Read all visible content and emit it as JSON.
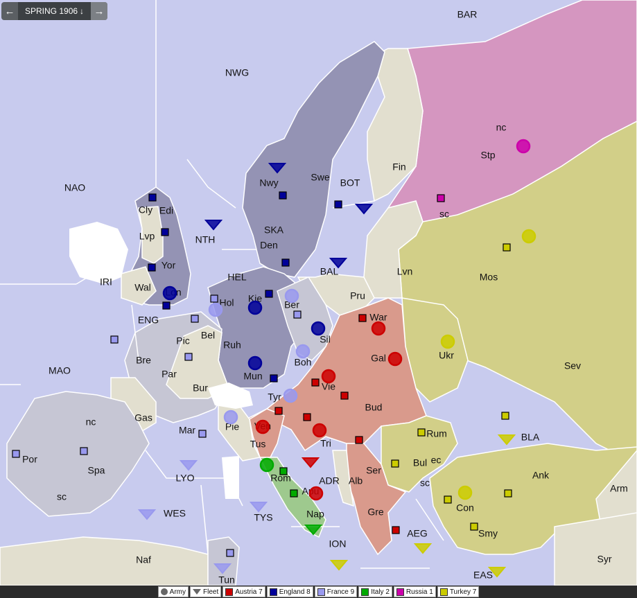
{
  "toolbar": {
    "prev_icon": "←",
    "season": "SPRING 1906",
    "season_icon": "↓",
    "next_icon": "→"
  },
  "colors": {
    "sea": "#c8cbee",
    "neutral": "#e2dfcf",
    "austria": "#d99a8c",
    "england": "#9493b4",
    "france": "#c6c6d4",
    "italy": "#9ec98e",
    "russia": "#d596c0",
    "turkey": "#d2cf88"
  },
  "legend": {
    "army": "Army",
    "fleet": "Fleet",
    "powers": [
      {
        "label": "Austria 7",
        "color": "#cc0000"
      },
      {
        "label": "England 8",
        "color": "#000099"
      },
      {
        "label": "France 9",
        "color": "#9999ee"
      },
      {
        "label": "Italy 2",
        "color": "#00aa00"
      },
      {
        "label": "Russia 1",
        "color": "#cc00aa"
      },
      {
        "label": "Turkey 7",
        "color": "#cccc00"
      }
    ]
  },
  "labels": [
    "BAR",
    "NWG",
    "NAO",
    "Cly",
    "Edi",
    "Lvp",
    "Yor",
    "Wal",
    "Lon",
    "IRI",
    "ENG",
    "NTH",
    "SKA",
    "Nwy",
    "Swe",
    "Fin",
    "BOT",
    "Stp",
    "nc",
    "sc",
    "Den",
    "HEL",
    "BAL",
    "Kie",
    "Ber",
    "Pru",
    "Lvn",
    "Mos",
    "Hol",
    "Bel",
    "Ruh",
    "Pic",
    "Bre",
    "Par",
    "Bur",
    "Mun",
    "Sil",
    "War",
    "Gal",
    "Boh",
    "Ukr",
    "Sev",
    "Tyr",
    "Vie",
    "Bud",
    "Gas",
    "Mar",
    "Pie",
    "Ven",
    "Tri",
    "Rum",
    "BLA",
    "MAO",
    "Spa",
    "Por",
    "sc",
    "nc",
    "LYO",
    "Tus",
    "Rom",
    "Apu",
    "ADR",
    "Ser",
    "Bul",
    "ec",
    "sc",
    "Alb",
    "Ank",
    "Arm",
    "Con",
    "WES",
    "TYS",
    "Nap",
    "Gre",
    "AEG",
    "Smy",
    "ION",
    "EAS",
    "Naf",
    "Tun",
    "Syr"
  ],
  "units": [
    {
      "type": "army",
      "power": "england",
      "province": "Lon"
    },
    {
      "type": "army",
      "power": "england",
      "province": "Kie"
    },
    {
      "type": "army",
      "power": "england",
      "province": "Sil"
    },
    {
      "type": "army",
      "power": "england",
      "province": "Mun"
    },
    {
      "type": "fleet",
      "power": "england",
      "province": "NTH"
    },
    {
      "type": "fleet",
      "power": "england",
      "province": "Nwy"
    },
    {
      "type": "fleet",
      "power": "england",
      "province": "BOT"
    },
    {
      "type": "fleet",
      "power": "england",
      "province": "BAL"
    },
    {
      "type": "army",
      "power": "france",
      "province": "Ber"
    },
    {
      "type": "army",
      "power": "france",
      "province": "Hol"
    },
    {
      "type": "army",
      "power": "france",
      "province": "Boh"
    },
    {
      "type": "army",
      "power": "france",
      "province": "Tyr"
    },
    {
      "type": "army",
      "power": "france",
      "province": "Pie"
    },
    {
      "type": "fleet",
      "power": "france",
      "province": "LYO"
    },
    {
      "type": "fleet",
      "power": "france",
      "province": "WES"
    },
    {
      "type": "fleet",
      "power": "france",
      "province": "TYS"
    },
    {
      "type": "fleet",
      "power": "france",
      "province": "Tun"
    },
    {
      "type": "army",
      "power": "austria",
      "province": "War"
    },
    {
      "type": "army",
      "power": "austria",
      "province": "Gal"
    },
    {
      "type": "army",
      "power": "austria",
      "province": "Vie"
    },
    {
      "type": "army",
      "power": "austria",
      "province": "Ven"
    },
    {
      "type": "army",
      "power": "austria",
      "province": "Tri"
    },
    {
      "type": "army",
      "power": "austria",
      "province": "Apu"
    },
    {
      "type": "fleet",
      "power": "austria",
      "province": "ADR"
    },
    {
      "type": "army",
      "power": "italy",
      "province": "Rom"
    },
    {
      "type": "fleet",
      "power": "italy",
      "province": "Nap"
    },
    {
      "type": "army",
      "power": "russia",
      "province": "Stp"
    },
    {
      "type": "army",
      "power": "turkey",
      "province": "Mos"
    },
    {
      "type": "army",
      "power": "turkey",
      "province": "Ukr"
    },
    {
      "type": "army",
      "power": "turkey",
      "province": "Con"
    },
    {
      "type": "fleet",
      "power": "turkey",
      "province": "BLA"
    },
    {
      "type": "fleet",
      "power": "turkey",
      "province": "AEG"
    },
    {
      "type": "fleet",
      "power": "turkey",
      "province": "ION"
    },
    {
      "type": "fleet",
      "power": "turkey",
      "province": "EAS"
    }
  ],
  "supply_centers": [
    {
      "power": "england",
      "province": "Lvp"
    },
    {
      "power": "england",
      "province": "Edi"
    },
    {
      "power": "england",
      "province": "Yor"
    },
    {
      "power": "england",
      "province": "Lon"
    },
    {
      "power": "england",
      "province": "Kie"
    },
    {
      "power": "england",
      "province": "Mun"
    },
    {
      "power": "england",
      "province": "Nwy"
    },
    {
      "power": "england",
      "province": "Swe"
    },
    {
      "power": "england",
      "province": "Den"
    },
    {
      "power": "france",
      "province": "Bre"
    },
    {
      "power": "france",
      "province": "Par"
    },
    {
      "power": "france",
      "province": "Mar"
    },
    {
      "power": "france",
      "province": "Ber"
    },
    {
      "power": "france",
      "province": "Hol"
    },
    {
      "power": "france",
      "province": "Bel"
    },
    {
      "power": "france",
      "province": "Spa"
    },
    {
      "power": "france",
      "province": "Por"
    },
    {
      "power": "france",
      "province": "Tun"
    },
    {
      "power": "austria",
      "province": "War"
    },
    {
      "power": "austria",
      "province": "Vie"
    },
    {
      "power": "austria",
      "province": "Bud"
    },
    {
      "power": "austria",
      "province": "Tri"
    },
    {
      "power": "austria",
      "province": "Ven"
    },
    {
      "power": "austria",
      "province": "Ser"
    },
    {
      "power": "austria",
      "province": "Gre"
    },
    {
      "power": "italy",
      "province": "Rom"
    },
    {
      "power": "italy",
      "province": "Nap"
    },
    {
      "power": "russia",
      "province": "Stp"
    },
    {
      "power": "turkey",
      "province": "Mos"
    },
    {
      "power": "turkey",
      "province": "Sev"
    },
    {
      "power": "turkey",
      "province": "Rum"
    },
    {
      "power": "turkey",
      "province": "Bul"
    },
    {
      "power": "turkey",
      "province": "Ank"
    },
    {
      "power": "turkey",
      "province": "Con"
    },
    {
      "power": "turkey",
      "province": "Smy"
    }
  ]
}
